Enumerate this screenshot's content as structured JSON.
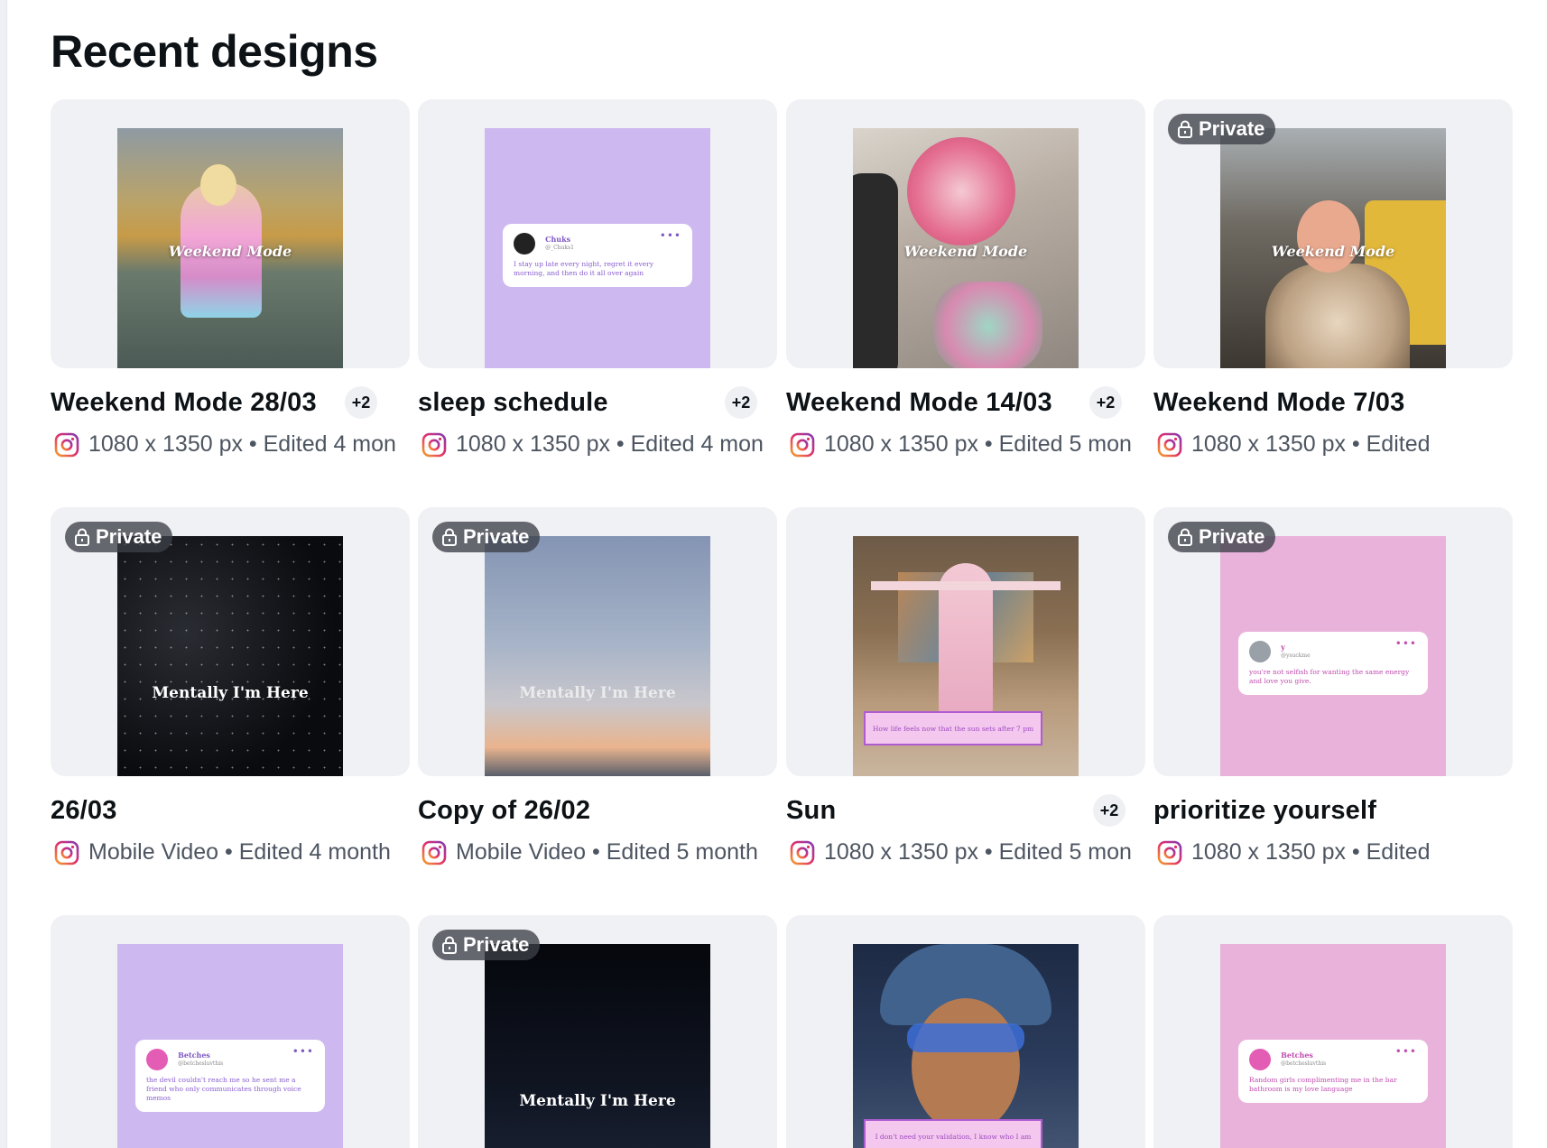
{
  "page": {
    "title": "Recent designs"
  },
  "badges": {
    "private_label": "Private"
  },
  "designs": [
    {
      "title": "Weekend Mode 28/03",
      "collaborators": "+2",
      "meta": "1080 x 1350 px • Edited 4 mon",
      "private": false,
      "overlay": "Weekend Mode"
    },
    {
      "title": "sleep schedule",
      "collaborators": "+2",
      "meta": "1080 x 1350 px • Edited 4 mon",
      "private": false,
      "tweet": {
        "name": "Chuks",
        "handle": "@_Chuks1",
        "body": "I stay up late every night, regret it every morning, and then do it all over again"
      }
    },
    {
      "title": "Weekend Mode 14/03",
      "collaborators": "+2",
      "meta": "1080 x 1350 px • Edited 5 mon",
      "private": false,
      "overlay": "Weekend Mode"
    },
    {
      "title": "Weekend Mode 7/03",
      "collaborators": "",
      "meta": "1080 x 1350 px • Edited",
      "private": true,
      "overlay": "Weekend Mode"
    },
    {
      "title": "26/03",
      "collaborators": "",
      "meta": "Mobile Video • Edited 4 month",
      "private": true,
      "overlay": "Mentally I'm Here"
    },
    {
      "title": "Copy of 26/02",
      "collaborators": "",
      "meta": "Mobile Video • Edited 5 month",
      "private": true,
      "overlay": "Mentally I'm Here"
    },
    {
      "title": "Sun",
      "collaborators": "+2",
      "meta": "1080 x 1350 px • Edited 5 mon",
      "private": false,
      "caption": "How life feels now that the sun sets after 7 pm"
    },
    {
      "title": "prioritize yourself",
      "collaborators": "",
      "meta": "1080 x 1350 px • Edited",
      "private": true,
      "tweet": {
        "name": "y",
        "handle": "@ysuckme",
        "body": "you're not selfish for wanting the same energy and love you give."
      }
    },
    {
      "title": "",
      "collaborators": "",
      "meta": "",
      "private": false,
      "tweet": {
        "name": "Betches",
        "handle": "@betchesluvthis",
        "body": "the devil couldn't reach me so he sent me a friend who only communicates through voice memos"
      }
    },
    {
      "title": "",
      "collaborators": "",
      "meta": "",
      "private": true,
      "overlay": "Mentally I'm Here"
    },
    {
      "title": "",
      "collaborators": "",
      "meta": "",
      "private": false,
      "caption": "I don't need your validation, I know who I am"
    },
    {
      "title": "",
      "collaborators": "",
      "meta": "",
      "private": false,
      "tweet": {
        "name": "Betches",
        "handle": "@betchesluvthis",
        "body": "Random girls complimenting me in the bar bathroom is my love language"
      }
    }
  ]
}
